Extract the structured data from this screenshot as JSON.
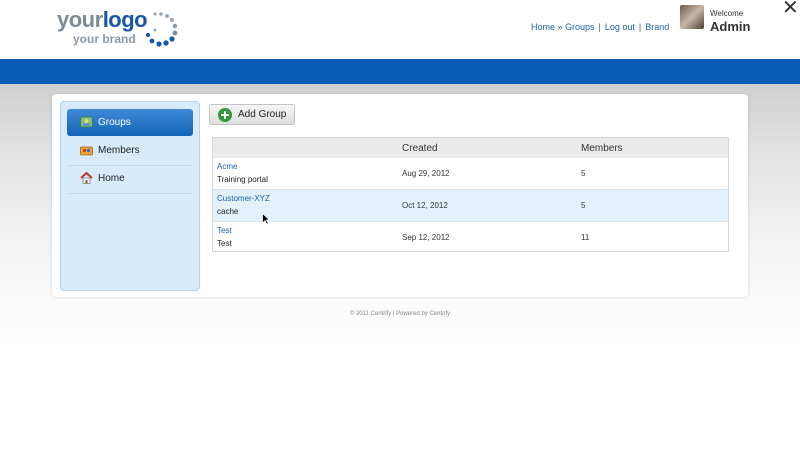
{
  "header": {
    "logo_your": "your",
    "logo_logo": "logo",
    "logo_brand": "your brand",
    "links": [
      "Home » Groups",
      "Log out",
      "Brand"
    ],
    "welcome": "Welcome",
    "user": "Admin",
    "close": "✕"
  },
  "sidebar": {
    "items": [
      {
        "label": "Groups",
        "icon": "groups-icon",
        "active": true
      },
      {
        "label": "Members",
        "icon": "members-icon",
        "active": false
      },
      {
        "label": "Home",
        "icon": "home-icon",
        "active": false
      }
    ]
  },
  "toolbar": {
    "add_label": "Add Group"
  },
  "table": {
    "columns": [
      "",
      "Created",
      "Members"
    ],
    "rows": [
      {
        "name": "Acme",
        "desc": "Training portal",
        "created": "Aug 29, 2012",
        "members": "5"
      },
      {
        "name": "Customer-XYZ",
        "desc": "cache",
        "created": "Oct 12, 2012",
        "members": "5"
      },
      {
        "name": "Test",
        "desc": "Test",
        "created": "Sep 12, 2012",
        "members": "11"
      }
    ]
  },
  "footer": {
    "text": "© 2011 Centrify | Powered by Centrify"
  },
  "colors": {
    "brand_blue": "#0a5bb6",
    "link": "#1e5fa5",
    "sidebar_bg": "#d7ebfa",
    "highlight_row": "#e2f1fc"
  }
}
